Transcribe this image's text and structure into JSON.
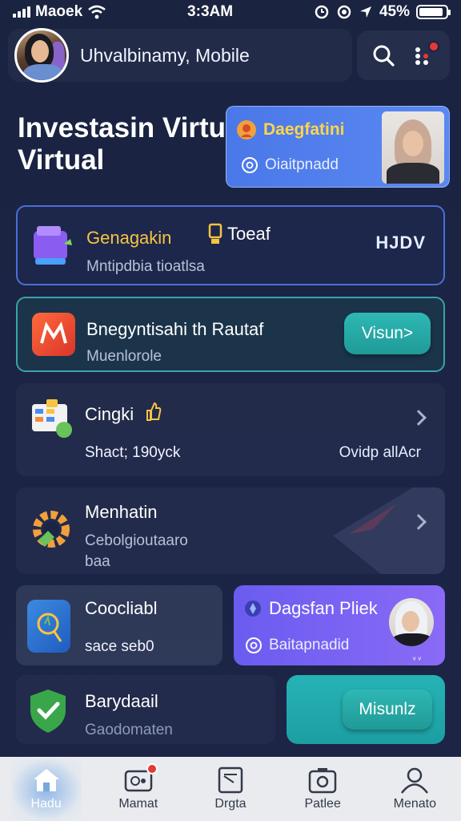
{
  "status_bar": {
    "carrier": "Maoek",
    "time": "3:3AM",
    "battery_text": "45%",
    "battery_level": 0.9
  },
  "header": {
    "user_name": "Uhvalbinamy, Mobile"
  },
  "page_title": [
    "Investasin Virtu",
    "Virtual"
  ],
  "promo_top": {
    "title": "Daegfatini",
    "subtitle": "Oiaitpnadd"
  },
  "cards": [
    {
      "title": "Genagakin",
      "title_extra": "Toeaf",
      "subtitle": "Mntipdbia tioatlsa",
      "right_text": "HJDV"
    },
    {
      "title": "Bnegyntisahi th Rautaf",
      "subtitle": "Muenlorole",
      "button": "Visun>"
    },
    {
      "title": "Cingki",
      "subtitle": "Shact; 190yck",
      "right_text": "Ovidp allAcr"
    },
    {
      "title": "Menhatin",
      "subtitle_lines": [
        "Cebolgioutaaro",
        "baa"
      ]
    }
  ],
  "small_card": {
    "title": "Coocliabl",
    "subtitle": "sace seb0"
  },
  "promo_small": {
    "title": "Dagsfan Pliek",
    "subtitle": "Baitapnadid",
    "marks": "ᵥ ᵥ"
  },
  "bottom_card": {
    "title": "Barydaail",
    "subtitle": "Gaodomaten",
    "button": "Misunlz"
  },
  "tabs": [
    {
      "label": "Hadu",
      "icon": "home-icon",
      "active": true
    },
    {
      "label": "Mamat",
      "icon": "wallet-icon",
      "active": false
    },
    {
      "label": "Drgta",
      "icon": "document-icon",
      "active": false
    },
    {
      "label": "Patlee",
      "icon": "camera-icon",
      "active": false
    },
    {
      "label": "Menato",
      "icon": "user-icon",
      "active": false
    }
  ],
  "colors": {
    "background": "#1b2444",
    "accent_blue": "#4a78e8",
    "accent_teal": "#26b3b6",
    "badge_red": "#e53935",
    "title_gold": "#ffd54a"
  }
}
